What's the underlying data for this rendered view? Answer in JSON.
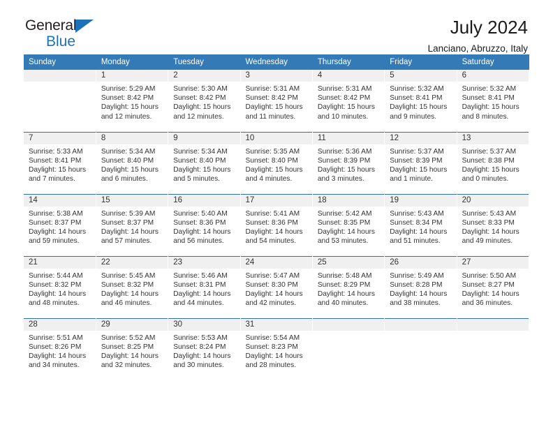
{
  "brand": {
    "line1": "General",
    "line2": "Blue",
    "triangle_color": "#1b72b8"
  },
  "header": {
    "title": "July 2024",
    "subtitle": "Lanciano, Abruzzo, Italy"
  },
  "theme": {
    "header_bg": "#337ab7",
    "daynum_bg": "#f0f0f0",
    "row_divider": "#2f6fa8"
  },
  "weekday_headers": [
    "Sunday",
    "Monday",
    "Tuesday",
    "Wednesday",
    "Thursday",
    "Friday",
    "Saturday"
  ],
  "weeks": [
    [
      {
        "day": "",
        "sunrise": "",
        "sunset": "",
        "daylight_line1": "",
        "daylight_line2": ""
      },
      {
        "day": "1",
        "sunrise": "Sunrise: 5:29 AM",
        "sunset": "Sunset: 8:42 PM",
        "daylight_line1": "Daylight: 15 hours",
        "daylight_line2": "and 12 minutes."
      },
      {
        "day": "2",
        "sunrise": "Sunrise: 5:30 AM",
        "sunset": "Sunset: 8:42 PM",
        "daylight_line1": "Daylight: 15 hours",
        "daylight_line2": "and 12 minutes."
      },
      {
        "day": "3",
        "sunrise": "Sunrise: 5:31 AM",
        "sunset": "Sunset: 8:42 PM",
        "daylight_line1": "Daylight: 15 hours",
        "daylight_line2": "and 11 minutes."
      },
      {
        "day": "4",
        "sunrise": "Sunrise: 5:31 AM",
        "sunset": "Sunset: 8:42 PM",
        "daylight_line1": "Daylight: 15 hours",
        "daylight_line2": "and 10 minutes."
      },
      {
        "day": "5",
        "sunrise": "Sunrise: 5:32 AM",
        "sunset": "Sunset: 8:41 PM",
        "daylight_line1": "Daylight: 15 hours",
        "daylight_line2": "and 9 minutes."
      },
      {
        "day": "6",
        "sunrise": "Sunrise: 5:32 AM",
        "sunset": "Sunset: 8:41 PM",
        "daylight_line1": "Daylight: 15 hours",
        "daylight_line2": "and 8 minutes."
      }
    ],
    [
      {
        "day": "7",
        "sunrise": "Sunrise: 5:33 AM",
        "sunset": "Sunset: 8:41 PM",
        "daylight_line1": "Daylight: 15 hours",
        "daylight_line2": "and 7 minutes."
      },
      {
        "day": "8",
        "sunrise": "Sunrise: 5:34 AM",
        "sunset": "Sunset: 8:40 PM",
        "daylight_line1": "Daylight: 15 hours",
        "daylight_line2": "and 6 minutes."
      },
      {
        "day": "9",
        "sunrise": "Sunrise: 5:34 AM",
        "sunset": "Sunset: 8:40 PM",
        "daylight_line1": "Daylight: 15 hours",
        "daylight_line2": "and 5 minutes."
      },
      {
        "day": "10",
        "sunrise": "Sunrise: 5:35 AM",
        "sunset": "Sunset: 8:40 PM",
        "daylight_line1": "Daylight: 15 hours",
        "daylight_line2": "and 4 minutes."
      },
      {
        "day": "11",
        "sunrise": "Sunrise: 5:36 AM",
        "sunset": "Sunset: 8:39 PM",
        "daylight_line1": "Daylight: 15 hours",
        "daylight_line2": "and 3 minutes."
      },
      {
        "day": "12",
        "sunrise": "Sunrise: 5:37 AM",
        "sunset": "Sunset: 8:39 PM",
        "daylight_line1": "Daylight: 15 hours",
        "daylight_line2": "and 1 minute."
      },
      {
        "day": "13",
        "sunrise": "Sunrise: 5:37 AM",
        "sunset": "Sunset: 8:38 PM",
        "daylight_line1": "Daylight: 15 hours",
        "daylight_line2": "and 0 minutes."
      }
    ],
    [
      {
        "day": "14",
        "sunrise": "Sunrise: 5:38 AM",
        "sunset": "Sunset: 8:37 PM",
        "daylight_line1": "Daylight: 14 hours",
        "daylight_line2": "and 59 minutes."
      },
      {
        "day": "15",
        "sunrise": "Sunrise: 5:39 AM",
        "sunset": "Sunset: 8:37 PM",
        "daylight_line1": "Daylight: 14 hours",
        "daylight_line2": "and 57 minutes."
      },
      {
        "day": "16",
        "sunrise": "Sunrise: 5:40 AM",
        "sunset": "Sunset: 8:36 PM",
        "daylight_line1": "Daylight: 14 hours",
        "daylight_line2": "and 56 minutes."
      },
      {
        "day": "17",
        "sunrise": "Sunrise: 5:41 AM",
        "sunset": "Sunset: 8:36 PM",
        "daylight_line1": "Daylight: 14 hours",
        "daylight_line2": "and 54 minutes."
      },
      {
        "day": "18",
        "sunrise": "Sunrise: 5:42 AM",
        "sunset": "Sunset: 8:35 PM",
        "daylight_line1": "Daylight: 14 hours",
        "daylight_line2": "and 53 minutes."
      },
      {
        "day": "19",
        "sunrise": "Sunrise: 5:43 AM",
        "sunset": "Sunset: 8:34 PM",
        "daylight_line1": "Daylight: 14 hours",
        "daylight_line2": "and 51 minutes."
      },
      {
        "day": "20",
        "sunrise": "Sunrise: 5:43 AM",
        "sunset": "Sunset: 8:33 PM",
        "daylight_line1": "Daylight: 14 hours",
        "daylight_line2": "and 49 minutes."
      }
    ],
    [
      {
        "day": "21",
        "sunrise": "Sunrise: 5:44 AM",
        "sunset": "Sunset: 8:32 PM",
        "daylight_line1": "Daylight: 14 hours",
        "daylight_line2": "and 48 minutes."
      },
      {
        "day": "22",
        "sunrise": "Sunrise: 5:45 AM",
        "sunset": "Sunset: 8:32 PM",
        "daylight_line1": "Daylight: 14 hours",
        "daylight_line2": "and 46 minutes."
      },
      {
        "day": "23",
        "sunrise": "Sunrise: 5:46 AM",
        "sunset": "Sunset: 8:31 PM",
        "daylight_line1": "Daylight: 14 hours",
        "daylight_line2": "and 44 minutes."
      },
      {
        "day": "24",
        "sunrise": "Sunrise: 5:47 AM",
        "sunset": "Sunset: 8:30 PM",
        "daylight_line1": "Daylight: 14 hours",
        "daylight_line2": "and 42 minutes."
      },
      {
        "day": "25",
        "sunrise": "Sunrise: 5:48 AM",
        "sunset": "Sunset: 8:29 PM",
        "daylight_line1": "Daylight: 14 hours",
        "daylight_line2": "and 40 minutes."
      },
      {
        "day": "26",
        "sunrise": "Sunrise: 5:49 AM",
        "sunset": "Sunset: 8:28 PM",
        "daylight_line1": "Daylight: 14 hours",
        "daylight_line2": "and 38 minutes."
      },
      {
        "day": "27",
        "sunrise": "Sunrise: 5:50 AM",
        "sunset": "Sunset: 8:27 PM",
        "daylight_line1": "Daylight: 14 hours",
        "daylight_line2": "and 36 minutes."
      }
    ],
    [
      {
        "day": "28",
        "sunrise": "Sunrise: 5:51 AM",
        "sunset": "Sunset: 8:26 PM",
        "daylight_line1": "Daylight: 14 hours",
        "daylight_line2": "and 34 minutes."
      },
      {
        "day": "29",
        "sunrise": "Sunrise: 5:52 AM",
        "sunset": "Sunset: 8:25 PM",
        "daylight_line1": "Daylight: 14 hours",
        "daylight_line2": "and 32 minutes."
      },
      {
        "day": "30",
        "sunrise": "Sunrise: 5:53 AM",
        "sunset": "Sunset: 8:24 PM",
        "daylight_line1": "Daylight: 14 hours",
        "daylight_line2": "and 30 minutes."
      },
      {
        "day": "31",
        "sunrise": "Sunrise: 5:54 AM",
        "sunset": "Sunset: 8:23 PM",
        "daylight_line1": "Daylight: 14 hours",
        "daylight_line2": "and 28 minutes."
      },
      {
        "day": "",
        "sunrise": "",
        "sunset": "",
        "daylight_line1": "",
        "daylight_line2": ""
      },
      {
        "day": "",
        "sunrise": "",
        "sunset": "",
        "daylight_line1": "",
        "daylight_line2": ""
      },
      {
        "day": "",
        "sunrise": "",
        "sunset": "",
        "daylight_line1": "",
        "daylight_line2": ""
      }
    ]
  ]
}
